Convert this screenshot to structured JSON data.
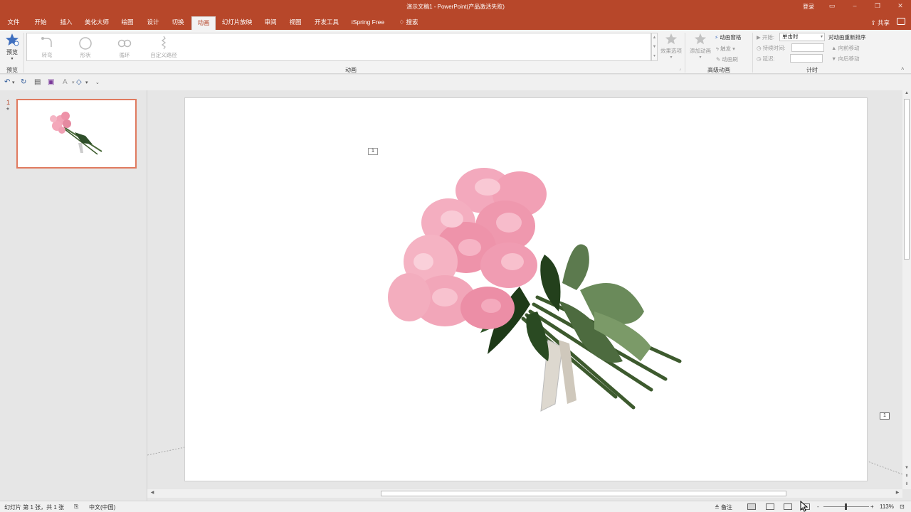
{
  "window": {
    "title": "演示文稿1  -  PowerPoint(产品激活失败)",
    "login": "登录"
  },
  "tabs": [
    "文件",
    "开始",
    "插入",
    "美化大师",
    "绘图",
    "设计",
    "切换",
    "动画",
    "幻灯片放映",
    "审阅",
    "视图",
    "开发工具",
    "iSpring Free",
    "搜索"
  ],
  "active_tab": "动画",
  "share": "共享",
  "ribbon": {
    "preview_label": "预览",
    "preview_group": "预览",
    "gallery": [
      "转弯",
      "形状",
      "循环",
      "自定义路径"
    ],
    "animation_group": "动画",
    "effect_options": "效果选项",
    "add_animation": "添加动画",
    "animation_pane": "动画窗格",
    "trigger": "触发",
    "animation_painter": "动画刷",
    "advanced_group": "高级动画",
    "start_label": "开始:",
    "start_value": "单击时",
    "duration_label": "持续时间:",
    "delay_label": "延迟:",
    "reorder_title": "对动画重新排序",
    "move_earlier": "向前移动",
    "move_later": "向后移动",
    "timing_group": "计时"
  },
  "thumbs": {
    "slide_number": "1",
    "star": "*"
  },
  "slide": {
    "anim_tag_1": "1",
    "anim_tag_2": "1"
  },
  "status": {
    "slide_info": "幻灯片 第 1 张，共 1 张",
    "language": "中文(中国)",
    "notes": "备注",
    "zoom": "113%"
  },
  "colors": {
    "accent": "#b7472a",
    "ribbon_bg": "#f3f3f3",
    "workspace": "#e6e6e6"
  }
}
